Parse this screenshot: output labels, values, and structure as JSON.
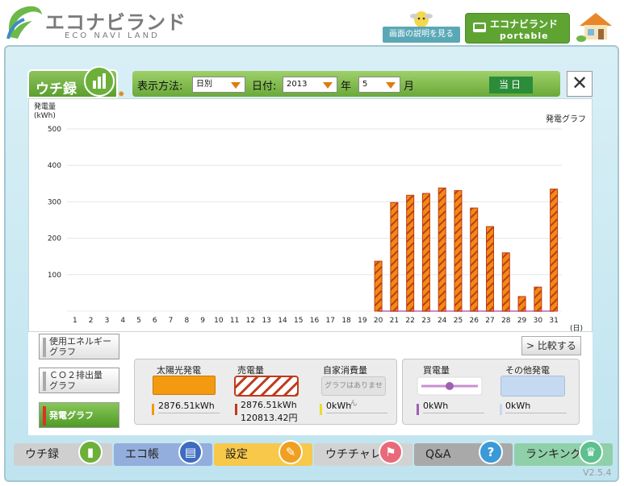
{
  "header": {
    "logo_title": "エコナビランド",
    "logo_subtitle": "ECO NAVI LAND",
    "help_button": "画面の説明を見る",
    "portable_title": "エコナビランド",
    "portable_subtitle": "portable"
  },
  "main_tab": {
    "label": "ウチ録"
  },
  "controls": {
    "display_method_label": "表示方法:",
    "display_method_value": "日別",
    "date_label": "日付:",
    "year_value": "2013",
    "year_suffix": "年",
    "month_value": "5",
    "month_suffix": "月",
    "today_button": "当日",
    "close_symbol": "✕"
  },
  "chart": {
    "title": "発電グラフ",
    "ylabel_line1": "発電量",
    "ylabel_line2": "(kWh)",
    "xlabel": "(日)"
  },
  "chart_data": {
    "type": "bar",
    "title": "発電グラフ",
    "ylabel": "発電量 (kWh)",
    "xlabel": "(日)",
    "ylim": [
      0,
      500
    ],
    "yticks": [
      100,
      200,
      300,
      400,
      500
    ],
    "categories": [
      "1",
      "2",
      "3",
      "4",
      "5",
      "6",
      "7",
      "8",
      "9",
      "10",
      "11",
      "12",
      "13",
      "14",
      "15",
      "16",
      "17",
      "18",
      "19",
      "20",
      "21",
      "22",
      "23",
      "24",
      "25",
      "26",
      "27",
      "28",
      "29",
      "30",
      "31"
    ],
    "values": [
      0,
      0,
      0,
      0,
      0,
      0,
      0,
      0,
      0,
      0,
      0,
      0,
      0,
      0,
      0,
      0,
      0,
      0,
      0,
      137,
      298,
      318,
      323,
      338,
      331,
      283,
      232,
      160,
      40,
      66,
      335
    ],
    "grid": true,
    "bar_style": "orange with red diagonal hatching",
    "bar_color": "#f08c10",
    "hatch_color": "#c03a1c",
    "baseline_color": "#c88ad0"
  },
  "side_buttons": [
    {
      "label": "使用エネルギーグラフ",
      "line1": "使用エネルギー",
      "line2": "グラフ"
    },
    {
      "label": "CO2排出量グラフ",
      "line1": "ＣＯ２排出量",
      "line2": "グラフ"
    },
    {
      "label": "発電グラフ",
      "line1": "発電グラフ",
      "line2": ""
    }
  ],
  "compare_button": "比較する",
  "legend": {
    "solar": {
      "title": "太陽光発電",
      "value": "2876.51kWh",
      "color": "#f39a10"
    },
    "sold": {
      "title": "売電量",
      "value": "2876.51kWh",
      "value2": "120813.42円"
    },
    "self": {
      "title": "自家消費量",
      "note": "グラフはありません",
      "value": "0kWh"
    },
    "bought": {
      "title": "買電量",
      "value": "0kWh"
    },
    "other": {
      "title": "その他発電",
      "value": "0kWh",
      "color": "#c5d9f0"
    }
  },
  "bottom_nav": [
    {
      "label": "ウチ録",
      "color": "#c9c9c9",
      "icon_color": "#6cb03a"
    },
    {
      "label": "エコ帳",
      "color": "#8aa6d8",
      "icon_color": "#3d6cc0"
    },
    {
      "label": "設定",
      "color": "#f7c84a",
      "icon_color": "#f0a020"
    },
    {
      "label": "ウチチャレ",
      "color": "#c9c9c9",
      "icon_color": "#e86a7a"
    },
    {
      "label": "Q&A",
      "color": "#a9a9a9",
      "icon_color": "#3a9ad8"
    },
    {
      "label": "ランキング",
      "color": "#8fd0a8",
      "icon_color": "#5cc090"
    }
  ],
  "version": "V2.5.4"
}
